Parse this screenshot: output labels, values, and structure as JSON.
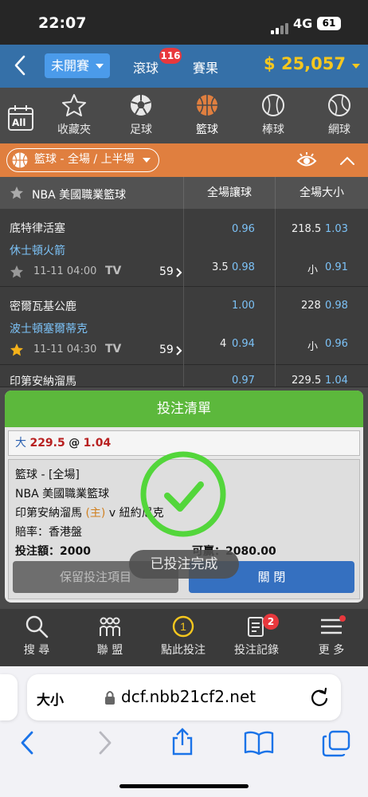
{
  "status": {
    "time": "22:07",
    "network": "4G",
    "battery": "61"
  },
  "header": {
    "tab_upcoming": "未開賽",
    "tab_live": "滾球",
    "live_count": "116",
    "tab_results": "賽果",
    "balance": "$ 25,057",
    "accent": "#3570a8",
    "balance_color": "#f6c71e"
  },
  "sports": {
    "all": "All",
    "items": [
      {
        "label": "收藏夾",
        "icon": "star-icon"
      },
      {
        "label": "足球",
        "icon": "soccer-icon"
      },
      {
        "label": "籃球",
        "icon": "basketball-icon",
        "active": true
      },
      {
        "label": "棒球",
        "icon": "baseball-icon"
      },
      {
        "label": "網球",
        "icon": "tennis-icon"
      }
    ]
  },
  "filter": {
    "label": "籃球 - 全場 / 上半場",
    "color": "#e07f3f"
  },
  "table": {
    "league": "NBA 美國職業籃球",
    "col_handicap": "全場讓球",
    "col_total": "全場大小"
  },
  "matches": [
    {
      "home": "底特律活塞",
      "away": "休士頓火箭",
      "datetime": "11-11 04:00",
      "tv": "TV",
      "more": "59",
      "hdp_home_odds": "0.96",
      "hdp_line": "3.5",
      "hdp_away_odds": "0.98",
      "ou_line": "218.5",
      "ou_over_odds": "1.03",
      "ou_under_label": "小",
      "ou_under_odds": "0.91",
      "starred": false
    },
    {
      "home": "密爾瓦基公鹿",
      "away": "波士頓塞爾蒂克",
      "datetime": "11-11 04:30",
      "tv": "TV",
      "more": "59",
      "hdp_home_odds": "1.00",
      "hdp_line": "4",
      "hdp_away_odds": "0.94",
      "ou_line": "228",
      "ou_over_odds": "0.98",
      "ou_under_label": "小",
      "ou_under_odds": "0.96",
      "starred": true
    },
    {
      "home": "印第安納溜馬",
      "hdp_home_odds": "0.97",
      "ou_line": "229.5",
      "ou_over_odds": "1.04"
    }
  ],
  "slip": {
    "title": "投注清單",
    "selection_side": "大",
    "selection_line": "229.5",
    "selection_at": "@",
    "selection_odds": "1.04",
    "sport_line": "籃球 - [全場]",
    "league": "NBA 美國職業籃球",
    "home": "印第安納溜馬",
    "home_tag": "(主)",
    "vs": "v",
    "away": "紐約尼克",
    "odds_type": "賠率：香港盤",
    "stake_label": "投注額：",
    "stake": "2000",
    "win_label": "可贏：",
    "win": "2080.00",
    "keep_button": "保留投注項目",
    "close_button": "關 閉",
    "toast": "已投注完成"
  },
  "bottom_nav": [
    {
      "label": "搜 尋",
      "icon": "search-icon"
    },
    {
      "label": "聯 盟",
      "icon": "league-icon"
    },
    {
      "label": "點此投注",
      "icon": "bet-count-icon",
      "count": "1"
    },
    {
      "label": "投注記錄",
      "icon": "records-icon",
      "badge": "2"
    },
    {
      "label": "更 多",
      "icon": "menu-icon"
    }
  ],
  "browser": {
    "text_size": "大小",
    "url": "dcf.nbb21cf2.net"
  }
}
